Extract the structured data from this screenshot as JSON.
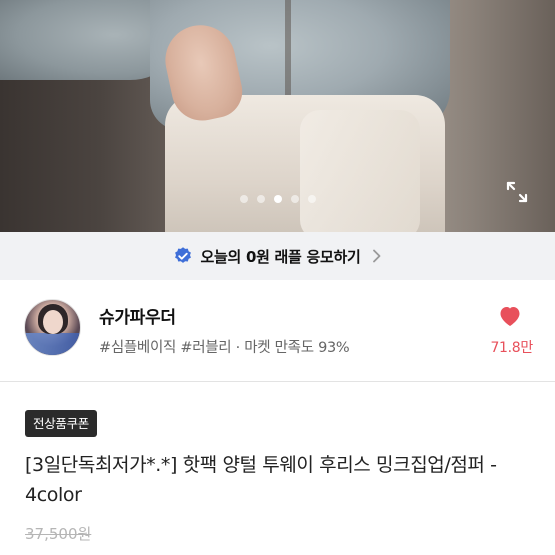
{
  "gallery": {
    "image_alt": "",
    "dots_count": 5,
    "active_dot_index": 2,
    "expand_icon": "expand-icon"
  },
  "raffle_banner": {
    "badge_icon": "verified-badge-icon",
    "text": "오늘의 0원 래플 응모하기",
    "chevron_icon": "chevron-right-icon",
    "badge_color": "#3f6fd8"
  },
  "seller": {
    "name": "슈가파우더",
    "tags": "#심플베이직 #러블리 · 마켓 만족도 93%",
    "likes": "71.8만",
    "heart_icon": "heart-icon",
    "heart_color": "#e8505b"
  },
  "product": {
    "coupon_label": "전상품쿠폰",
    "title": "[3일단독최저가*.*] 핫팩 양털 투웨이 후리스 밍크집업/점퍼 - 4color",
    "original_price": "37,500원"
  }
}
